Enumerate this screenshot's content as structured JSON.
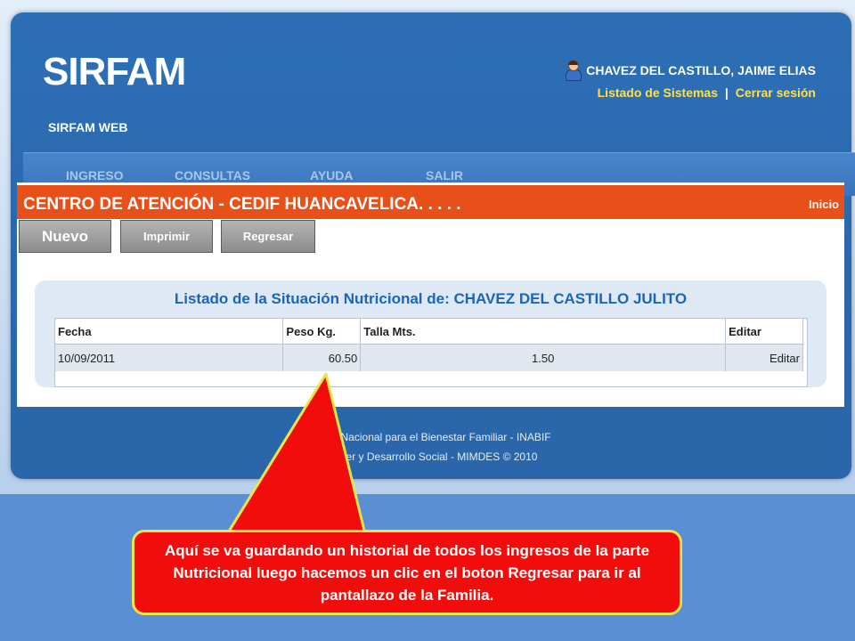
{
  "header": {
    "logo": "SIRFAM",
    "subtitle": "SIRFAM WEB",
    "user_name": "CHAVEZ DEL CASTILLO, JAIME ELIAS",
    "link_systems": "Listado de Sistemas",
    "link_separator": "|",
    "link_logout": "Cerrar sesión"
  },
  "nav": {
    "items": [
      "INGRESO",
      "CONSULTAS",
      "AYUDA",
      "SALIR"
    ]
  },
  "section": {
    "title": "CENTRO DE ATENCIÓN - CEDIF HUANCAVELICA. . . . .",
    "home_link": "Inicio"
  },
  "toolbar": {
    "new_label": "Nuevo",
    "print_label": "Imprimir",
    "back_label": "Regresar"
  },
  "panel": {
    "title": "Listado de la Situación Nutricional de: CHAVEZ DEL CASTILLO JULITO"
  },
  "table": {
    "headers": [
      "Fecha",
      "Peso Kg.",
      "Talla Mts.",
      "Editar"
    ],
    "rows": [
      {
        "date": "10/09/2011",
        "weight": "60.50",
        "height": "1.50",
        "edit": "Editar"
      }
    ]
  },
  "footer": {
    "line1": "P                     egral Nacional para el Bienestar Familiar - INABIF",
    "line2": "la Mujer y Desarrollo Social - MIMDES © 2010"
  },
  "callout": {
    "text": "Aquí se va guardando un historial de todos los ingresos de la parte Nutricional luego  hacemos un clic en el boton Regresar para ir al pantallazo  de la Familia."
  },
  "colors": {
    "accent_orange": "#e8501a",
    "frame_blue": "#2d6fb6",
    "link_yellow": "#ffe04a",
    "callout_red": "#f20c0c"
  }
}
